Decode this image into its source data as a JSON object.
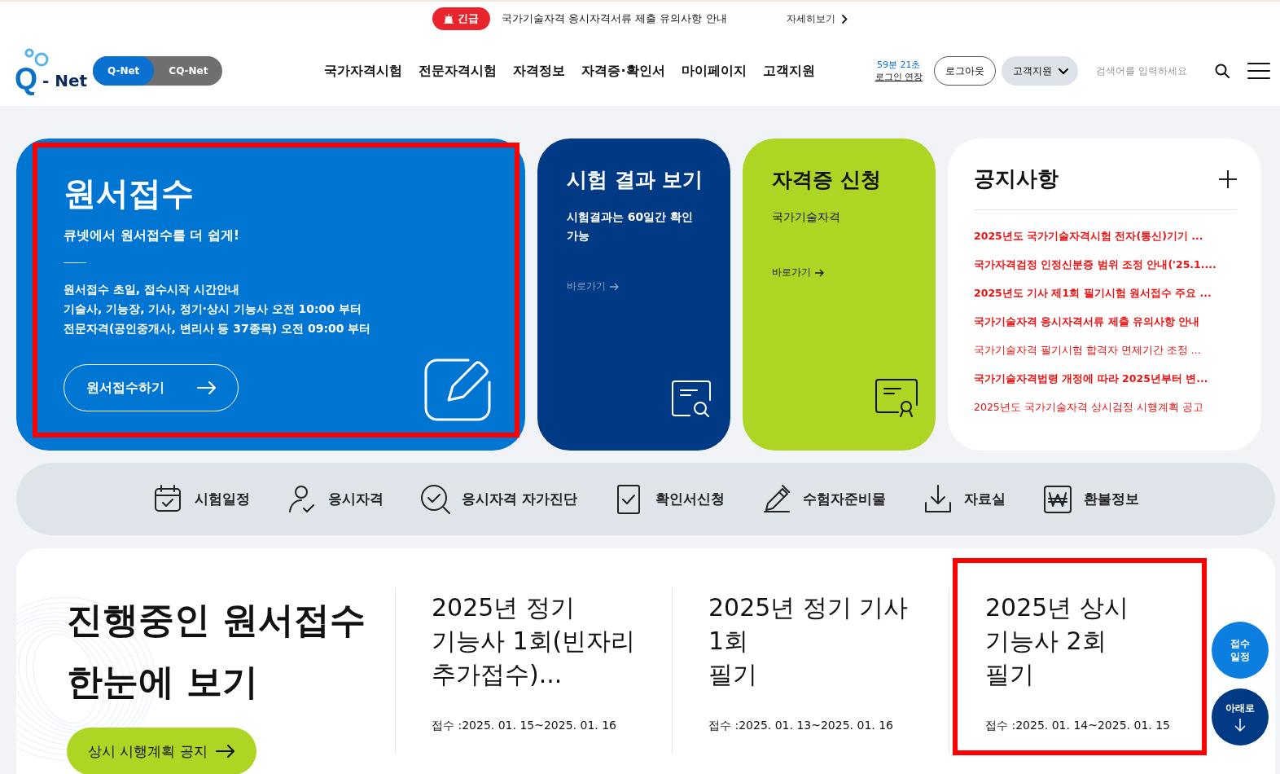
{
  "alert": {
    "badge": "긴급",
    "message": "국가기술자격 응시자격서류 제출 유의사항 안내",
    "more": "자세히보기"
  },
  "header": {
    "logo": {
      "mark": "Q",
      "text": "- Net"
    },
    "site_toggle": [
      {
        "label": "Q-Net",
        "selected": true
      },
      {
        "label": "CQ-Net",
        "selected": false
      }
    ],
    "nav": [
      "국가자격시험",
      "전문자격시험",
      "자격정보",
      "자격증·확인서",
      "마이페이지",
      "고객지원"
    ],
    "session": {
      "time": "59분 21초",
      "extend": "로그인 연장"
    },
    "buttons": [
      {
        "label": "로그아웃",
        "kind": "outline"
      },
      {
        "label": "고객지원",
        "kind": "dropdown"
      }
    ],
    "search": {
      "placeholder": "검색어를 입력하세요"
    }
  },
  "cards": [
    {
      "kind": "apply",
      "title": "원서접수",
      "subtitle": "큐넷에서 원서접수를 더 쉽게!",
      "lines": [
        "원서접수 초일, 접수시작 시간안내",
        "기술사, 기능장, 기사, 정기·상시 기능사 오전 10:00 부터",
        "전문자격(공인중개사, 변리사 등 37종목) 오전 09:00 부터"
      ],
      "button": "원서접수하기",
      "highlighted": true
    },
    {
      "kind": "result",
      "title": "시험 결과 보기",
      "subtitle": "시험결과는 60일간 확인 가능",
      "link": "바로가기",
      "highlighted": false
    },
    {
      "kind": "license",
      "title": "자격증 신청",
      "subtitle": "국가기술자격",
      "link": "바로가기",
      "highlighted": false
    }
  ],
  "notices": {
    "title": "공지사항",
    "items": [
      {
        "text": "2025년도 국가기술자격시험 전자(통신)기기 ...",
        "bold": true
      },
      {
        "text": "국가자격검정 인정신분증 범위 조정 안내('25.1....",
        "bold": true
      },
      {
        "text": "2025년도 기사 제1회 필기시험 원서접수 주요 ...",
        "bold": true
      },
      {
        "text": "국가기술자격 응시자격서류 제출 유의사항 안내",
        "bold": true
      },
      {
        "text": "국가기술자격 필기시험 합격자 면제기간 조정 ...",
        "bold": false
      },
      {
        "text": "국가기술자격법령 개정에 따라 2025년부터 변...",
        "bold": true
      },
      {
        "text": "2025년도 국가기술자격 상시검정 시행계획 공고",
        "bold": false
      }
    ]
  },
  "quick_menu": [
    "시험일정",
    "응시자격",
    "응시자격 자가진단",
    "확인서신청",
    "수험자준비물",
    "자료실",
    "환불정보"
  ],
  "ongoing": {
    "title_lines": [
      "진행중인 원서접수",
      "한눈에 보기"
    ],
    "button": "상시 시행계획 공지",
    "exams": [
      {
        "title_lines": [
          "2025년 정기",
          "기능사 1회(빈자리",
          "추가접수)..."
        ],
        "period": "접수 :2025. 01. 15~2025. 01. 16",
        "highlighted": false
      },
      {
        "title_lines": [
          "2025년 정기 기사",
          "1회",
          "필기"
        ],
        "period": "접수 :2025. 01. 13~2025. 01. 16",
        "highlighted": false
      },
      {
        "title_lines": [
          "2025년 상시",
          "기능사 2회",
          "필기"
        ],
        "period": "접수 :2025. 01. 14~2025. 01. 15",
        "highlighted": true
      }
    ]
  },
  "floating": [
    {
      "label": "접수\n일정",
      "kind": "schedule"
    },
    {
      "label": "아래로",
      "kind": "down"
    }
  ]
}
